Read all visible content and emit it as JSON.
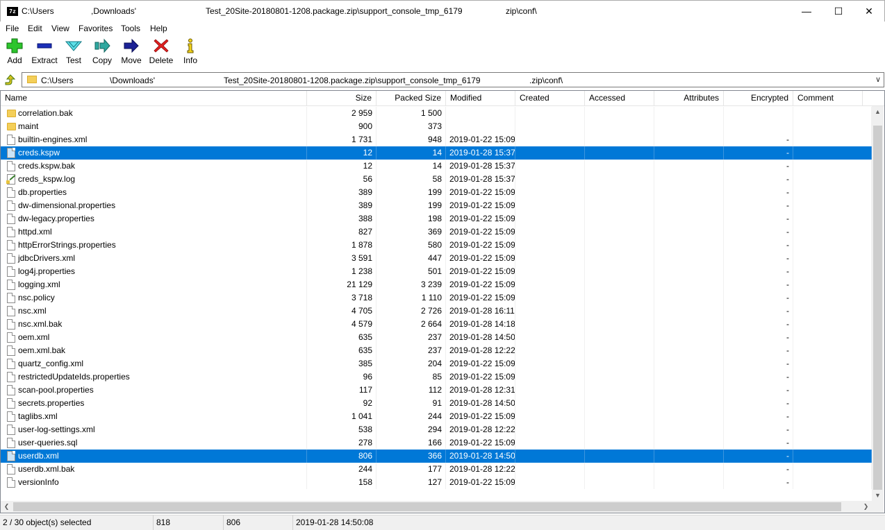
{
  "window": {
    "title_segments": [
      "C:\\Users",
      ",Downloads'",
      "Test_20Site-20180801-1208.package.zip\\support_console_tmp_6179",
      "zip\\conf\\"
    ],
    "app_icon_text": "7z",
    "minimize_glyph": "—",
    "maximize_glyph": "☐",
    "close_glyph": "✕"
  },
  "menu": [
    "File",
    "Edit",
    "View",
    "Favorites",
    "Tools",
    "Help"
  ],
  "toolbar": [
    {
      "label": "Add",
      "icon": "add-icon"
    },
    {
      "label": "Extract",
      "icon": "extract-icon"
    },
    {
      "label": "Test",
      "icon": "test-icon"
    },
    {
      "label": "Copy",
      "icon": "copy-icon"
    },
    {
      "label": "Move",
      "icon": "move-icon"
    },
    {
      "label": "Delete",
      "icon": "delete-icon"
    },
    {
      "label": "Info",
      "icon": "info-icon"
    }
  ],
  "address": {
    "segments": [
      "C:\\Users",
      "\\Downloads'",
      "Test_20Site-20180801-1208.package.zip\\support_console_tmp_6179",
      ".zip\\conf\\"
    ],
    "dropdown_glyph": "∨"
  },
  "columns": [
    "Name",
    "Size",
    "Packed Size",
    "Modified",
    "Created",
    "Accessed",
    "Attributes",
    "Encrypted",
    "Comment"
  ],
  "rows": [
    {
      "name": "correlation.bak",
      "type": "folder",
      "size": "2 959",
      "packed": "1 500",
      "modified": "",
      "encrypted": "",
      "selected": false
    },
    {
      "name": "maint",
      "type": "folder",
      "size": "900",
      "packed": "373",
      "modified": "",
      "encrypted": "",
      "selected": false
    },
    {
      "name": "builtin-engines.xml",
      "type": "file",
      "size": "1 731",
      "packed": "948",
      "modified": "2019-01-22 15:09",
      "encrypted": "-",
      "selected": false
    },
    {
      "name": "creds.kspw",
      "type": "file",
      "size": "12",
      "packed": "14",
      "modified": "2019-01-28 15:37",
      "encrypted": "-",
      "selected": true
    },
    {
      "name": "creds.kspw.bak",
      "type": "file",
      "size": "12",
      "packed": "14",
      "modified": "2019-01-28 15:37",
      "encrypted": "-",
      "selected": false
    },
    {
      "name": "creds_kspw.log",
      "type": "log",
      "size": "56",
      "packed": "58",
      "modified": "2019-01-28 15:37",
      "encrypted": "-",
      "selected": false
    },
    {
      "name": "db.properties",
      "type": "file",
      "size": "389",
      "packed": "199",
      "modified": "2019-01-22 15:09",
      "encrypted": "-",
      "selected": false
    },
    {
      "name": "dw-dimensional.properties",
      "type": "file",
      "size": "389",
      "packed": "199",
      "modified": "2019-01-22 15:09",
      "encrypted": "-",
      "selected": false
    },
    {
      "name": "dw-legacy.properties",
      "type": "file",
      "size": "388",
      "packed": "198",
      "modified": "2019-01-22 15:09",
      "encrypted": "-",
      "selected": false
    },
    {
      "name": "httpd.xml",
      "type": "file",
      "size": "827",
      "packed": "369",
      "modified": "2019-01-22 15:09",
      "encrypted": "-",
      "selected": false
    },
    {
      "name": "httpErrorStrings.properties",
      "type": "file",
      "size": "1 878",
      "packed": "580",
      "modified": "2019-01-22 15:09",
      "encrypted": "-",
      "selected": false
    },
    {
      "name": "jdbcDrivers.xml",
      "type": "file",
      "size": "3 591",
      "packed": "447",
      "modified": "2019-01-22 15:09",
      "encrypted": "-",
      "selected": false
    },
    {
      "name": "log4j.properties",
      "type": "file",
      "size": "1 238",
      "packed": "501",
      "modified": "2019-01-22 15:09",
      "encrypted": "-",
      "selected": false
    },
    {
      "name": "logging.xml",
      "type": "file",
      "size": "21 129",
      "packed": "3 239",
      "modified": "2019-01-22 15:09",
      "encrypted": "-",
      "selected": false
    },
    {
      "name": "nsc.policy",
      "type": "file",
      "size": "3 718",
      "packed": "1 110",
      "modified": "2019-01-22 15:09",
      "encrypted": "-",
      "selected": false
    },
    {
      "name": "nsc.xml",
      "type": "file",
      "size": "4 705",
      "packed": "2 726",
      "modified": "2019-01-28 16:11",
      "encrypted": "-",
      "selected": false
    },
    {
      "name": "nsc.xml.bak",
      "type": "file",
      "size": "4 579",
      "packed": "2 664",
      "modified": "2019-01-28 14:18",
      "encrypted": "-",
      "selected": false
    },
    {
      "name": "oem.xml",
      "type": "file",
      "size": "635",
      "packed": "237",
      "modified": "2019-01-28 14:50",
      "encrypted": "-",
      "selected": false
    },
    {
      "name": "oem.xml.bak",
      "type": "file",
      "size": "635",
      "packed": "237",
      "modified": "2019-01-28 12:22",
      "encrypted": "-",
      "selected": false
    },
    {
      "name": "quartz_config.xml",
      "type": "file",
      "size": "385",
      "packed": "204",
      "modified": "2019-01-22 15:09",
      "encrypted": "-",
      "selected": false
    },
    {
      "name": "restrictedUpdateIds.properties",
      "type": "file",
      "size": "96",
      "packed": "85",
      "modified": "2019-01-22 15:09",
      "encrypted": "-",
      "selected": false
    },
    {
      "name": "scan-pool.properties",
      "type": "file",
      "size": "117",
      "packed": "112",
      "modified": "2019-01-28 12:31",
      "encrypted": "-",
      "selected": false
    },
    {
      "name": "secrets.properties",
      "type": "file",
      "size": "92",
      "packed": "91",
      "modified": "2019-01-28 14:50",
      "encrypted": "-",
      "selected": false
    },
    {
      "name": "taglibs.xml",
      "type": "file",
      "size": "1 041",
      "packed": "244",
      "modified": "2019-01-22 15:09",
      "encrypted": "-",
      "selected": false
    },
    {
      "name": "user-log-settings.xml",
      "type": "file",
      "size": "538",
      "packed": "294",
      "modified": "2019-01-28 12:22",
      "encrypted": "-",
      "selected": false
    },
    {
      "name": "user-queries.sql",
      "type": "file",
      "size": "278",
      "packed": "166",
      "modified": "2019-01-22 15:09",
      "encrypted": "-",
      "selected": false
    },
    {
      "name": "userdb.xml",
      "type": "file",
      "size": "806",
      "packed": "366",
      "modified": "2019-01-28 14:50",
      "encrypted": "-",
      "selected": true
    },
    {
      "name": "userdb.xml.bak",
      "type": "file",
      "size": "244",
      "packed": "177",
      "modified": "2019-01-28 12:22",
      "encrypted": "-",
      "selected": false
    },
    {
      "name": "versionInfo",
      "type": "file",
      "size": "158",
      "packed": "127",
      "modified": "2019-01-22 15:09",
      "encrypted": "-",
      "selected": false
    }
  ],
  "scroll": {
    "up": "▲",
    "down": "▼",
    "left": "❮",
    "right": "❯"
  },
  "status": {
    "selection": "2 / 30 object(s) selected",
    "size": "818",
    "packed": "806",
    "modified": "2019-01-28 14:50:08"
  },
  "colors": {
    "selection": "#0078d7",
    "folder": "#f4cf59"
  }
}
